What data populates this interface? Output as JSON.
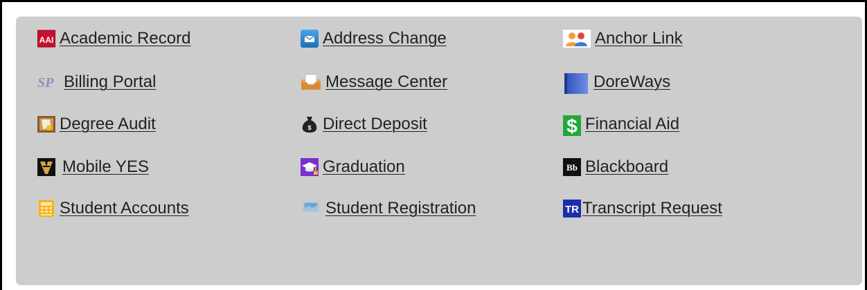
{
  "links": [
    {
      "label": "Academic Record",
      "icon": "academic-record-icon"
    },
    {
      "label": "Address Change",
      "icon": "envelope-icon"
    },
    {
      "label": "Anchor Link",
      "icon": "people-icon"
    },
    {
      "label": "Billing Portal",
      "icon": "sp-text-icon",
      "icon_text": "SP"
    },
    {
      "label": "Message Center",
      "icon": "inbox-icon"
    },
    {
      "label": "DoreWays",
      "icon": "blue-book-icon"
    },
    {
      "label": "Degree Audit",
      "icon": "certificate-icon"
    },
    {
      "label": "Direct Deposit",
      "icon": "money-bag-icon",
      "icon_text": "$"
    },
    {
      "label": "Financial Aid",
      "icon": "dollar-sign-icon",
      "icon_text": "$"
    },
    {
      "label": "Mobile YES",
      "icon": "vanderbilt-v-icon"
    },
    {
      "label": "Graduation",
      "icon": "graduation-cap-icon"
    },
    {
      "label": "Blackboard",
      "icon": "blackboard-icon",
      "icon_text": "Bb"
    },
    {
      "label": "Student Accounts",
      "icon": "calculator-icon"
    },
    {
      "label": "Student Registration",
      "icon": "monitor-icon"
    },
    {
      "label": "Transcript Request",
      "icon": "tr-icon",
      "icon_text": "TR"
    }
  ],
  "colors": {
    "panel_bg": "#cdcdcd",
    "link_text": "#222222",
    "frame": "#000000"
  }
}
